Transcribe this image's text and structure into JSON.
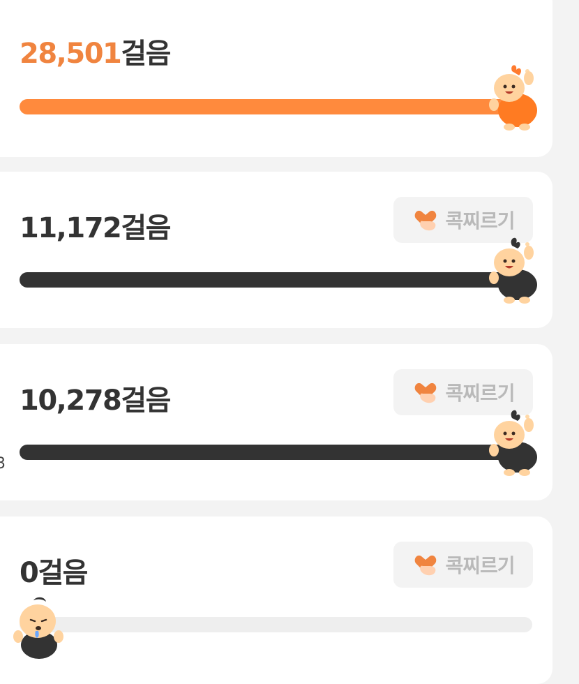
{
  "cards": [
    {
      "steps_number": "28,501",
      "steps_unit": "걸음",
      "progress": 1.0,
      "bar_color": "#ff8a3d",
      "character": "orange-walker",
      "highlight": true
    },
    {
      "steps_number": "11,172",
      "steps_unit": "걸음",
      "poke_label": "콕찌르기",
      "progress": 1.0,
      "bar_color": "#333333",
      "character": "black-walker"
    },
    {
      "steps_number": "10,278",
      "steps_unit": "걸음",
      "poke_label": "콕찌르기",
      "progress": 1.0,
      "bar_color": "#333333",
      "character": "black-walker"
    },
    {
      "steps_number": "0",
      "steps_unit": "걸음",
      "poke_label": "콕찌르기",
      "progress": 0.0,
      "bar_color": "#eeeeee",
      "character": "sad-walker"
    }
  ],
  "colors": {
    "accent": "#f0843f",
    "text": "#333333",
    "muted": "#b9b9b9",
    "card": "#ffffff",
    "background": "#f3f3f3"
  }
}
